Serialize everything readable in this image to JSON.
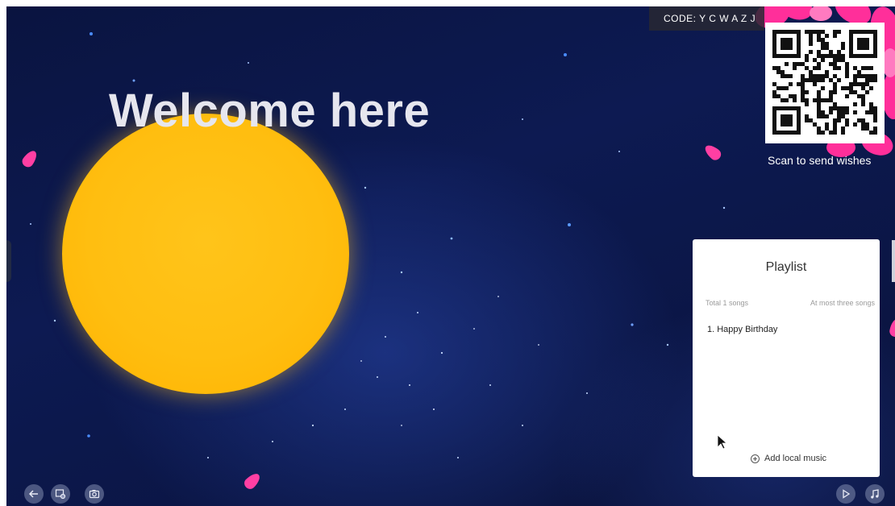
{
  "screen": {
    "title": "Welcome here"
  },
  "code_bar": {
    "label": "CODE:",
    "code": "Y C W A Z J"
  },
  "qr": {
    "caption": "Scan to send wishes"
  },
  "playlist": {
    "title": "Playlist",
    "total": "Total 1 songs",
    "limit": "At most three songs",
    "songs": [
      "1. Happy Birthday"
    ],
    "add_label": "Add local music"
  },
  "toolbar_left": {
    "icons": [
      "back-arrow-icon",
      "screen-settings-icon",
      "camera-icon"
    ]
  },
  "toolbar_right": {
    "icons": [
      "play-icon",
      "music-note-icon"
    ]
  },
  "colors": {
    "sun": "#ffbe10",
    "petal": "#ff3fa3",
    "background": "#0b1646"
  }
}
